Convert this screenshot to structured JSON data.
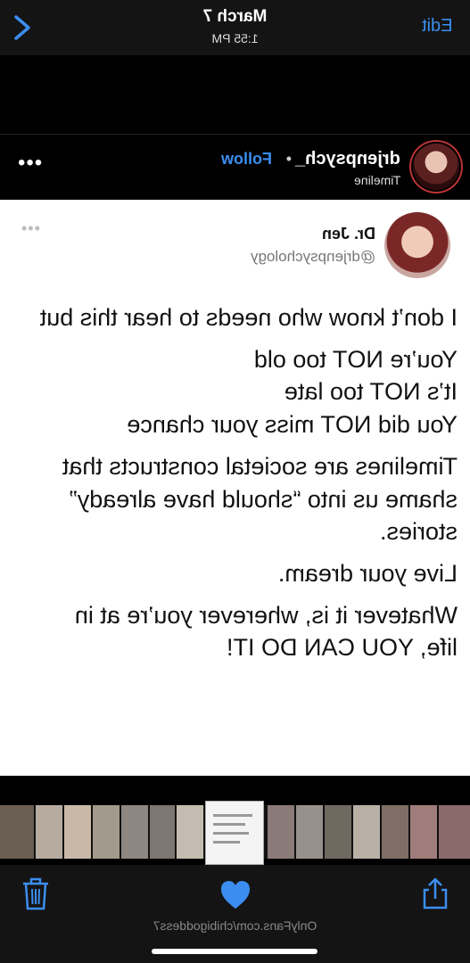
{
  "topbar": {
    "date": "March 7",
    "time": "1:55 PM",
    "edit_label": "Edit"
  },
  "instagram": {
    "username": "drjenpsych_",
    "subtitle": "Timeline",
    "follow_label": "Follow",
    "separator": "•",
    "more": "•••"
  },
  "tweet": {
    "name": "Dr. Jen",
    "handle": "@drjenpsychology",
    "more": "•••",
    "paragraphs": [
      "I don’t know who needs to hear this but",
      "You’re NOT too old\nIt’s NOT too late\nYou did NOT miss your chance",
      "Timelines are societal constructs that shame us into “should have already” stories.",
      "Live your dream.",
      "Whatever it is, wherever you’re at in life, YOU CAN DO IT!"
    ]
  },
  "watermark": "OnlyFans.com/chibigoddess7",
  "colors": {
    "accent": "#3b8ef0",
    "bar": "#141414"
  },
  "icons": [
    "chevron-right-icon",
    "trash-icon",
    "heart-icon",
    "share-icon"
  ]
}
